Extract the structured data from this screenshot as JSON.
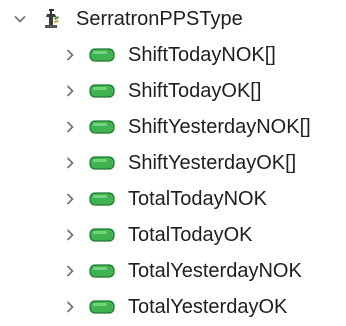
{
  "tree": {
    "root": {
      "label": "SerratronPPSType",
      "expanded": true,
      "icon": "object-type-icon"
    },
    "children": [
      {
        "label": "ShiftTodayNOK[]",
        "expanded": false,
        "icon": "variable-icon"
      },
      {
        "label": "ShiftTodayOK[]",
        "expanded": false,
        "icon": "variable-icon"
      },
      {
        "label": "ShiftYesterdayNOK[]",
        "expanded": false,
        "icon": "variable-icon"
      },
      {
        "label": "ShiftYesterdayOK[]",
        "expanded": false,
        "icon": "variable-icon"
      },
      {
        "label": "TotalTodayNOK",
        "expanded": false,
        "icon": "variable-icon"
      },
      {
        "label": "TotalTodayOK",
        "expanded": false,
        "icon": "variable-icon"
      },
      {
        "label": "TotalYesterdayNOK",
        "expanded": false,
        "icon": "variable-icon"
      },
      {
        "label": "TotalYesterdayOK",
        "expanded": false,
        "icon": "variable-icon"
      }
    ]
  },
  "colors": {
    "variable_icon_fill": "#3fb34f",
    "variable_icon_stroke": "#1d7a2c",
    "chevron": "#6e6e6e",
    "text": "#1e1e1e"
  }
}
